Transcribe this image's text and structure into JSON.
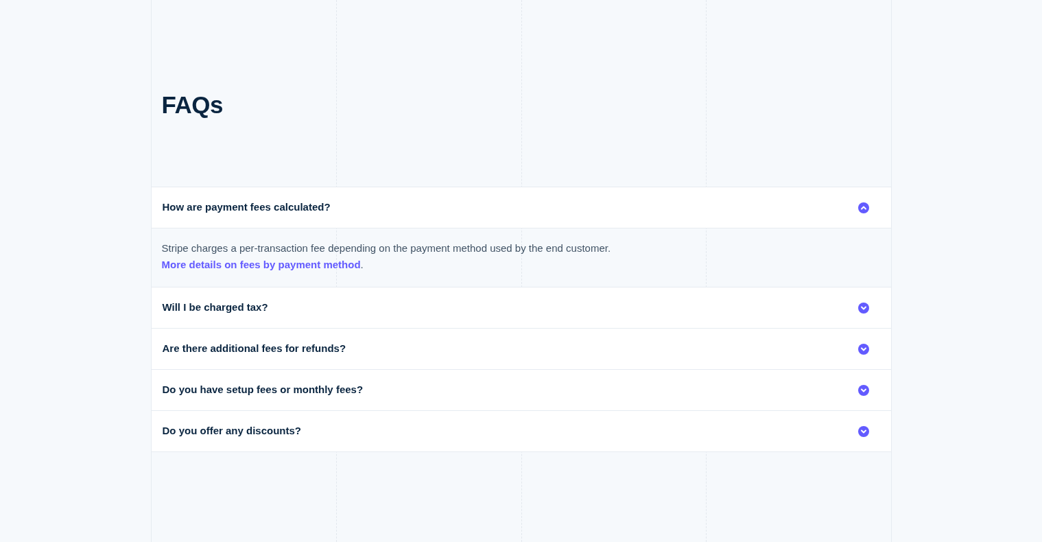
{
  "title": "FAQs",
  "faqs": [
    {
      "question": "How are payment fees calculated?",
      "expanded": true,
      "answer": "Stripe charges a per-transaction fee depending on the payment method used by the end customer.",
      "link": "More details on fees by payment method",
      "answer_end": "."
    },
    {
      "question": "Will I be charged tax?",
      "expanded": false
    },
    {
      "question": "Are there additional fees for refunds?",
      "expanded": false
    },
    {
      "question": "Do you have setup fees or monthly fees?",
      "expanded": false
    },
    {
      "question": "Do you offer any discounts?",
      "expanded": false
    }
  ]
}
